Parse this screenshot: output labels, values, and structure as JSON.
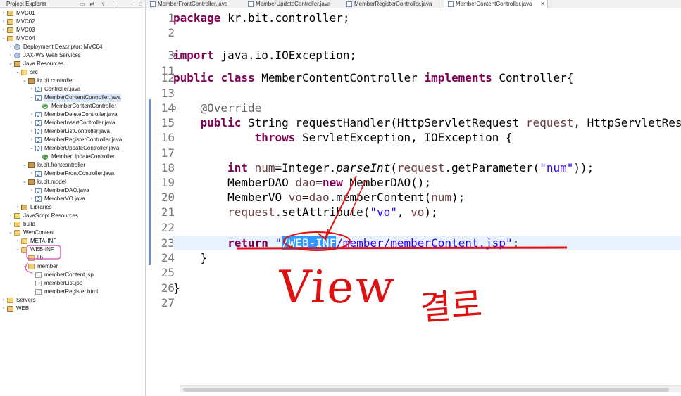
{
  "explorer": {
    "title": "Project Explorer",
    "close": "✕",
    "tree": [
      {
        "label": "MVC01",
        "icon": "project-icon",
        "level": 0,
        "twisty": "›"
      },
      {
        "label": "MVC02",
        "icon": "project-icon",
        "level": 0,
        "twisty": "›"
      },
      {
        "label": "MVC03",
        "icon": "project-icon",
        "level": 0,
        "twisty": "›"
      },
      {
        "label": "MVC04",
        "icon": "project-icon",
        "level": 0,
        "twisty": "⌄"
      },
      {
        "label": "Deployment Descriptor: MVC04",
        "icon": "gear-icon",
        "level": 1,
        "twisty": "›"
      },
      {
        "label": "JAX-WS Web Services",
        "icon": "gear-icon",
        "level": 1,
        "twisty": "›"
      },
      {
        "label": "Java Resources",
        "icon": "jar-icon",
        "level": 1,
        "twisty": "⌄"
      },
      {
        "label": "src",
        "icon": "folder-icon",
        "level": 2,
        "twisty": "⌄"
      },
      {
        "label": "kr.bit.controller",
        "icon": "package-icon",
        "level": 3,
        "twisty": "⌄"
      },
      {
        "label": "Controller.java",
        "icon": "java-file-icon",
        "level": 4,
        "twisty": "›"
      },
      {
        "label": "MemberContentController.java",
        "icon": "java-file-icon",
        "level": 4,
        "twisty": "⌄",
        "selected": true
      },
      {
        "label": "MemberContentController",
        "icon": "class-icon",
        "level": 5,
        "twisty": ""
      },
      {
        "label": "MemberDeleteController.java",
        "icon": "java-file-icon",
        "level": 4,
        "twisty": "›"
      },
      {
        "label": "MemberInsertController.java",
        "icon": "java-file-icon",
        "level": 4,
        "twisty": "›"
      },
      {
        "label": "MemberListController.java",
        "icon": "java-file-icon",
        "level": 4,
        "twisty": "›"
      },
      {
        "label": "MemberRegisterController.java",
        "icon": "java-file-icon",
        "level": 4,
        "twisty": "›"
      },
      {
        "label": "MemberUpdateController.java",
        "icon": "java-file-icon",
        "level": 4,
        "twisty": "⌄"
      },
      {
        "label": "MemberUpdateController",
        "icon": "class-icon",
        "level": 5,
        "twisty": ""
      },
      {
        "label": "kr.bit.frontcontroller",
        "icon": "package-icon",
        "level": 3,
        "twisty": "⌄"
      },
      {
        "label": "MemberFrontController.java",
        "icon": "java-file-icon",
        "level": 4,
        "twisty": "›"
      },
      {
        "label": "kr.bit.model",
        "icon": "package-icon",
        "level": 3,
        "twisty": "⌄"
      },
      {
        "label": "MemberDAO.java",
        "icon": "java-file-icon",
        "level": 4,
        "twisty": "›"
      },
      {
        "label": "MemberVO.java",
        "icon": "java-file-icon",
        "level": 4,
        "twisty": "›"
      },
      {
        "label": "Libraries",
        "icon": "jar-icon",
        "level": 2,
        "twisty": "›"
      },
      {
        "label": "JavaScript Resources",
        "icon": "js-icon",
        "level": 1,
        "twisty": "›"
      },
      {
        "label": "build",
        "icon": "folder-icon",
        "level": 1,
        "twisty": "›"
      },
      {
        "label": "WebContent",
        "icon": "folder-icon",
        "level": 1,
        "twisty": "⌄"
      },
      {
        "label": "META-INF",
        "icon": "folder-icon",
        "level": 2,
        "twisty": "›"
      },
      {
        "label": "WEB-INF",
        "icon": "folder-icon",
        "level": 2,
        "twisty": "⌄"
      },
      {
        "label": "lib",
        "icon": "folder-icon",
        "level": 3,
        "twisty": ""
      },
      {
        "label": "member",
        "icon": "folder-icon",
        "level": 3,
        "twisty": "⌄"
      },
      {
        "label": "memberContent.jsp",
        "icon": "file-icon",
        "level": 4,
        "twisty": ""
      },
      {
        "label": "memberList.jsp",
        "icon": "file-icon",
        "level": 4,
        "twisty": ""
      },
      {
        "label": "memberRegister.html",
        "icon": "file-icon",
        "level": 4,
        "twisty": ""
      },
      {
        "label": "Servers",
        "icon": "folder-icon",
        "level": 0,
        "twisty": "›"
      },
      {
        "label": "WEB",
        "icon": "project-icon",
        "level": 0,
        "twisty": "›"
      }
    ]
  },
  "tabs": [
    {
      "label": "MemberFrontController.java",
      "active": false
    },
    {
      "label": "MemberUpdateController.java",
      "active": false
    },
    {
      "label": "MemberRegisterController.java",
      "active": false
    },
    {
      "label": "MemberContentController.java",
      "active": true,
      "close": "✕"
    }
  ],
  "editor": {
    "line_numbers": [
      "1",
      "2",
      "3",
      "11",
      "12",
      "13",
      "14",
      "15",
      "16",
      "17",
      "18",
      "19",
      "20",
      "21",
      "22",
      "23",
      "24",
      "25",
      "26",
      "27"
    ],
    "fold_markers": {
      "3": "⊕",
      "14": "⊖"
    },
    "current_line": "23"
  },
  "annotation": {
    "text": "View",
    "korean": "결로"
  },
  "colors": {
    "keyword": "#7f0055",
    "string": "#2a00ff",
    "annotation": "#646464",
    "variable": "#6a3e3e",
    "selection": "#3399ff",
    "ink": "#e01010"
  }
}
